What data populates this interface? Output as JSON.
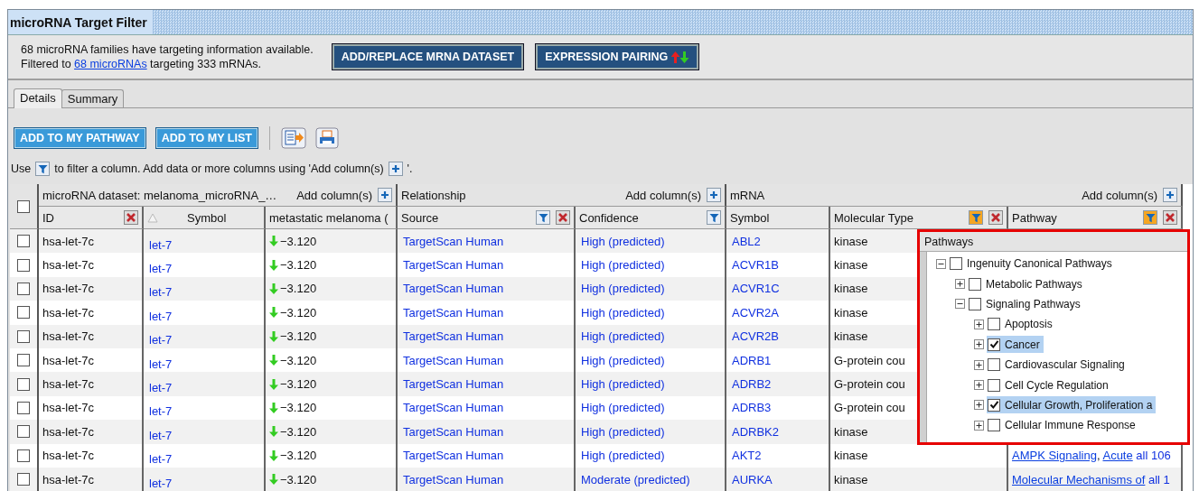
{
  "window": {
    "title": "microRNA Target Filter"
  },
  "info": {
    "line_1": "68 microRNA families have targeting information available.",
    "line_2_before": "Filtered to ",
    "line_2_link": "68 microRNAs",
    "line_2_after": " targeting 333 mRNAs."
  },
  "header_buttons": [
    {
      "label": "ADD/REPLACE MRNA DATASET",
      "kind": "plain"
    },
    {
      "label": "EXPRESSION PAIRING",
      "kind": "pairing"
    }
  ],
  "tabs": [
    {
      "label": "Details",
      "selected": true
    },
    {
      "label": "Summary",
      "selected": false
    }
  ],
  "toolbar_buttons": [
    "ADD TO MY PATHWAY",
    "ADD TO MY LIST"
  ],
  "hint": [
    "Use",
    "to filter a column. Add data or more columns using 'Add column(s)",
    "'."
  ],
  "table": {
    "select_all_checked": false,
    "groups": [
      {
        "title": "microRNA dataset: melanoma_microRNA_…",
        "add_label": "Add column(s)",
        "columns": [
          {
            "label": "ID",
            "filter": false,
            "removable": true,
            "sorted": false
          },
          {
            "label": "Symbol",
            "filter": false,
            "removable": false,
            "sorted": true
          },
          {
            "label": "metastatic melanoma (",
            "filter": false,
            "removable": false,
            "sorted": false
          }
        ]
      },
      {
        "title": "Relationship",
        "add_label": "Add column(s)",
        "columns": [
          {
            "label": "Source",
            "filter": true,
            "filter_active": false,
            "removable": true,
            "sorted": false
          },
          {
            "label": "Confidence",
            "filter": true,
            "filter_active": false,
            "removable": false,
            "sorted": false
          }
        ]
      },
      {
        "title": "mRNA",
        "add_label": "Add column(s)",
        "columns": [
          {
            "label": "Symbol",
            "filter": false,
            "removable": false,
            "sorted": false
          },
          {
            "label": "Molecular Type",
            "filter": true,
            "filter_active": true,
            "removable": true,
            "sorted": false
          },
          {
            "label": "Pathway",
            "filter": true,
            "filter_active": true,
            "removable": true,
            "sorted": false
          }
        ]
      }
    ],
    "rows": [
      {
        "checked": false,
        "id": "hsa-let-7c",
        "symbol": "let-7",
        "expression": {
          "down": true,
          "value": "−3.120"
        },
        "source": "TargetScan Human",
        "confidence": "High (predicted)",
        "mrna_symbol": "ABL2",
        "molecular_type": "kinase"
      },
      {
        "checked": false,
        "id": "hsa-let-7c",
        "symbol": "let-7",
        "expression": {
          "down": true,
          "value": "−3.120"
        },
        "source": "TargetScan Human",
        "confidence": "High (predicted)",
        "mrna_symbol": "ACVR1B",
        "molecular_type": "kinase"
      },
      {
        "checked": false,
        "id": "hsa-let-7c",
        "symbol": "let-7",
        "expression": {
          "down": true,
          "value": "−3.120"
        },
        "source": "TargetScan Human",
        "confidence": "High (predicted)",
        "mrna_symbol": "ACVR1C",
        "molecular_type": "kinase"
      },
      {
        "checked": false,
        "id": "hsa-let-7c",
        "symbol": "let-7",
        "expression": {
          "down": true,
          "value": "−3.120"
        },
        "source": "TargetScan Human",
        "confidence": "High (predicted)",
        "mrna_symbol": "ACVR2A",
        "molecular_type": "kinase"
      },
      {
        "checked": false,
        "id": "hsa-let-7c",
        "symbol": "let-7",
        "expression": {
          "down": true,
          "value": "−3.120"
        },
        "source": "TargetScan Human",
        "confidence": "High (predicted)",
        "mrna_symbol": "ACVR2B",
        "molecular_type": "kinase"
      },
      {
        "checked": false,
        "id": "hsa-let-7c",
        "symbol": "let-7",
        "expression": {
          "down": true,
          "value": "−3.120"
        },
        "source": "TargetScan Human",
        "confidence": "High (predicted)",
        "mrna_symbol": "ADRB1",
        "molecular_type": "G-protein cou"
      },
      {
        "checked": false,
        "id": "hsa-let-7c",
        "symbol": "let-7",
        "expression": {
          "down": true,
          "value": "−3.120"
        },
        "source": "TargetScan Human",
        "confidence": "High (predicted)",
        "mrna_symbol": "ADRB2",
        "molecular_type": "G-protein cou"
      },
      {
        "checked": false,
        "id": "hsa-let-7c",
        "symbol": "let-7",
        "expression": {
          "down": true,
          "value": "−3.120"
        },
        "source": "TargetScan Human",
        "confidence": "High (predicted)",
        "mrna_symbol": "ADRB3",
        "molecular_type": "G-protein cou"
      },
      {
        "checked": false,
        "id": "hsa-let-7c",
        "symbol": "let-7",
        "expression": {
          "down": true,
          "value": "−3.120"
        },
        "source": "TargetScan Human",
        "confidence": "High (predicted)",
        "mrna_symbol": "ADRBK2",
        "molecular_type": "kinase"
      },
      {
        "checked": false,
        "id": "hsa-let-7c",
        "symbol": "let-7",
        "expression": {
          "down": true,
          "value": "−3.120"
        },
        "source": "TargetScan Human",
        "confidence": "High (predicted)",
        "mrna_symbol": "AKT2",
        "molecular_type": "kinase",
        "pathway": [
          {
            "kind": "link",
            "text": "AMPK Signaling"
          },
          {
            "kind": "text",
            "text": ", "
          },
          {
            "kind": "link",
            "text": "Acute"
          },
          {
            "kind": "more",
            "text": " all 106"
          }
        ]
      },
      {
        "checked": false,
        "id": "hsa-let-7c",
        "symbol": "let-7",
        "expression": {
          "down": true,
          "value": "−3.120"
        },
        "source": "TargetScan Human",
        "confidence": "Moderate (predicted)",
        "mrna_symbol": "AURKA",
        "molecular_type": "kinase",
        "pathway": [
          {
            "kind": "link",
            "text": "Molecular Mechanisms of"
          },
          {
            "kind": "more",
            "text": " all 1"
          }
        ]
      }
    ]
  },
  "pathway_popup": {
    "title": "Pathways",
    "tree": [
      {
        "label": "Ingenuity Canonical Pathways",
        "expanded": true,
        "checked": false,
        "selected": false,
        "children": [
          {
            "label": "Metabolic Pathways",
            "expanded": false,
            "checked": false,
            "selected": false
          },
          {
            "label": "Signaling Pathways",
            "expanded": true,
            "checked": false,
            "selected": false,
            "children": [
              {
                "label": "Apoptosis",
                "expanded": false,
                "checked": false,
                "selected": false
              },
              {
                "label": "Cancer",
                "expanded": false,
                "checked": true,
                "selected": true
              },
              {
                "label": "Cardiovascular Signaling",
                "expanded": false,
                "checked": false,
                "selected": false
              },
              {
                "label": "Cell Cycle Regulation",
                "expanded": false,
                "checked": false,
                "selected": false
              },
              {
                "label": "Cellular Growth, Proliferation a",
                "expanded": false,
                "checked": true,
                "selected": true
              },
              {
                "label": "Cellular Immune Response",
                "expanded": false,
                "checked": false,
                "selected": false
              }
            ]
          }
        ]
      }
    ]
  }
}
